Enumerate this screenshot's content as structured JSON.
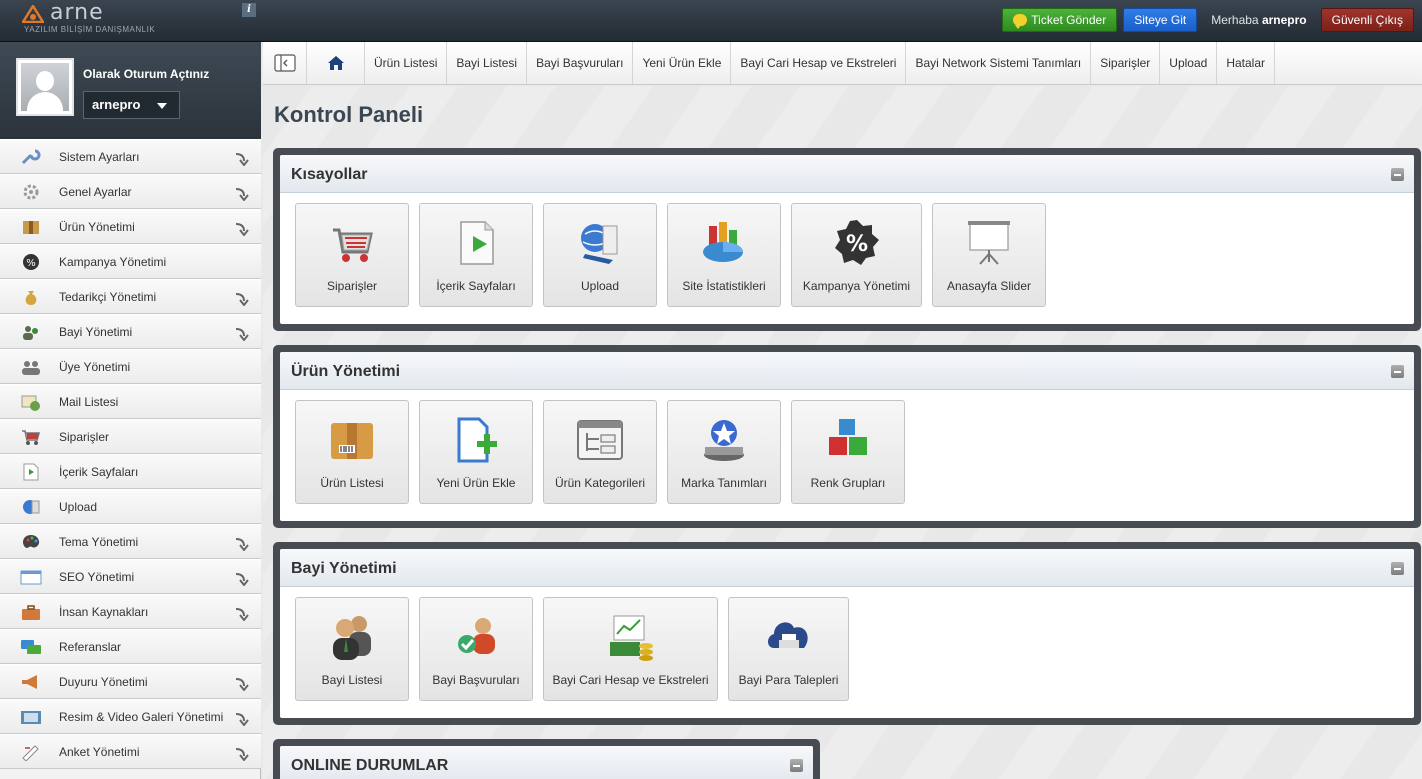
{
  "header": {
    "logo_word": "arne",
    "logo_sub": "YAZILIM BİLİŞİM DANIŞMANLIK",
    "info_label": "i",
    "ticket_button": "Ticket Gönder",
    "site_button": "Siteye Git",
    "greeting": "Merhaba",
    "username": "arnepro",
    "logout_button": "Güvenli Çıkış"
  },
  "userbox": {
    "status": "Olarak Oturum Açtınız",
    "username": "arnepro"
  },
  "sidebar": {
    "items": [
      {
        "label": "Sistem Ayarları",
        "icon": "wrench-icon",
        "color": "#6a8fc7",
        "has_arrow": true
      },
      {
        "label": "Genel Ayarlar",
        "icon": "gear-icon",
        "color": "#9a9a9a",
        "has_arrow": true
      },
      {
        "label": "Ürün Yönetimi",
        "icon": "box-icon",
        "color": "#c89a4a",
        "has_arrow": true
      },
      {
        "label": "Kampanya Yönetimi",
        "icon": "percent-icon",
        "color": "#333333",
        "has_arrow": false
      },
      {
        "label": "Tedarikçi Yönetimi",
        "icon": "money-bag-icon",
        "color": "#d4a640",
        "has_arrow": true
      },
      {
        "label": "Bayi Yönetimi",
        "icon": "dealer-icon",
        "color": "#5a6a4a",
        "has_arrow": true
      },
      {
        "label": "Üye Yönetimi",
        "icon": "users-icon",
        "color": "#777777",
        "has_arrow": false
      },
      {
        "label": "Mail Listesi",
        "icon": "mail-icon",
        "color": "#6aa04a",
        "has_arrow": false
      },
      {
        "label": "Siparişler",
        "icon": "cart-icon",
        "color": "#c04040",
        "has_arrow": false
      },
      {
        "label": "İçerik Sayfaları",
        "icon": "page-icon",
        "color": "#3a9a3a",
        "has_arrow": false
      },
      {
        "label": "Upload",
        "icon": "upload-globe-icon",
        "color": "#3a7ad0",
        "has_arrow": false
      },
      {
        "label": "Tema Yönetimi",
        "icon": "palette-icon",
        "color": "#444444",
        "has_arrow": true
      },
      {
        "label": "SEO Yönetimi",
        "icon": "browser-icon",
        "color": "#6a9ad0",
        "has_arrow": true
      },
      {
        "label": "İnsan Kaynakları",
        "icon": "briefcase-icon",
        "color": "#d07a3a",
        "has_arrow": true
      },
      {
        "label": "Referanslar",
        "icon": "chat-bubbles-icon",
        "color": "#3a8ad0",
        "has_arrow": false
      },
      {
        "label": "Duyuru Yönetimi",
        "icon": "megaphone-icon",
        "color": "#d07a3a",
        "has_arrow": true
      },
      {
        "label": "Resim & Video Galeri Yönetimi",
        "icon": "gallery-icon",
        "color": "#5a8ab0",
        "has_arrow": true
      },
      {
        "label": "Anket Yönetimi",
        "icon": "survey-icon",
        "color": "#aaaaaa",
        "has_arrow": true
      }
    ]
  },
  "tabs": [
    {
      "label": "Ürün Listesi"
    },
    {
      "label": "Bayi Listesi"
    },
    {
      "label": "Bayi Başvuruları"
    },
    {
      "label": "Yeni Ürün Ekle"
    },
    {
      "label": "Bayi Cari Hesap ve Ekstreleri"
    },
    {
      "label": "Bayi Network Sistemi Tanımları"
    },
    {
      "label": "Siparişler"
    },
    {
      "label": "Upload"
    },
    {
      "label": "Hatalar"
    }
  ],
  "page": {
    "title": "Kontrol Paneli"
  },
  "panels": [
    {
      "title": "Kısayollar",
      "tiles": [
        {
          "label": "Siparişler",
          "icon": "cart-icon"
        },
        {
          "label": "İçerik Sayfaları",
          "icon": "page-play-icon"
        },
        {
          "label": "Upload",
          "icon": "upload-globe-icon"
        },
        {
          "label": "Site İstatistikleri",
          "icon": "stats-chart-icon"
        },
        {
          "label": "Kampanya Yönetimi",
          "icon": "percent-badge-icon"
        },
        {
          "label": "Anasayfa Slider",
          "icon": "projector-screen-icon"
        }
      ]
    },
    {
      "title": "Ürün Yönetimi",
      "tiles": [
        {
          "label": "Ürün Listesi",
          "icon": "box-barcode-icon"
        },
        {
          "label": "Yeni Ürün Ekle",
          "icon": "doc-plus-icon"
        },
        {
          "label": "Ürün Kategorileri",
          "icon": "category-tree-icon"
        },
        {
          "label": "Marka Tanımları",
          "icon": "brand-star-icon"
        },
        {
          "label": "Renk Grupları",
          "icon": "color-cubes-icon"
        }
      ]
    },
    {
      "title": "Bayi Yönetimi",
      "tiles": [
        {
          "label": "Bayi Listesi",
          "icon": "dealers-icon"
        },
        {
          "label": "Bayi Başvuruları",
          "icon": "applicant-check-icon"
        },
        {
          "label": "Bayi Cari Hesap ve Ekstreleri",
          "icon": "account-cash-icon"
        },
        {
          "label": "Bayi Para Talepleri",
          "icon": "cloud-printer-icon"
        }
      ]
    },
    {
      "title": "ONLINE DURUMLAR",
      "tiles": []
    }
  ]
}
